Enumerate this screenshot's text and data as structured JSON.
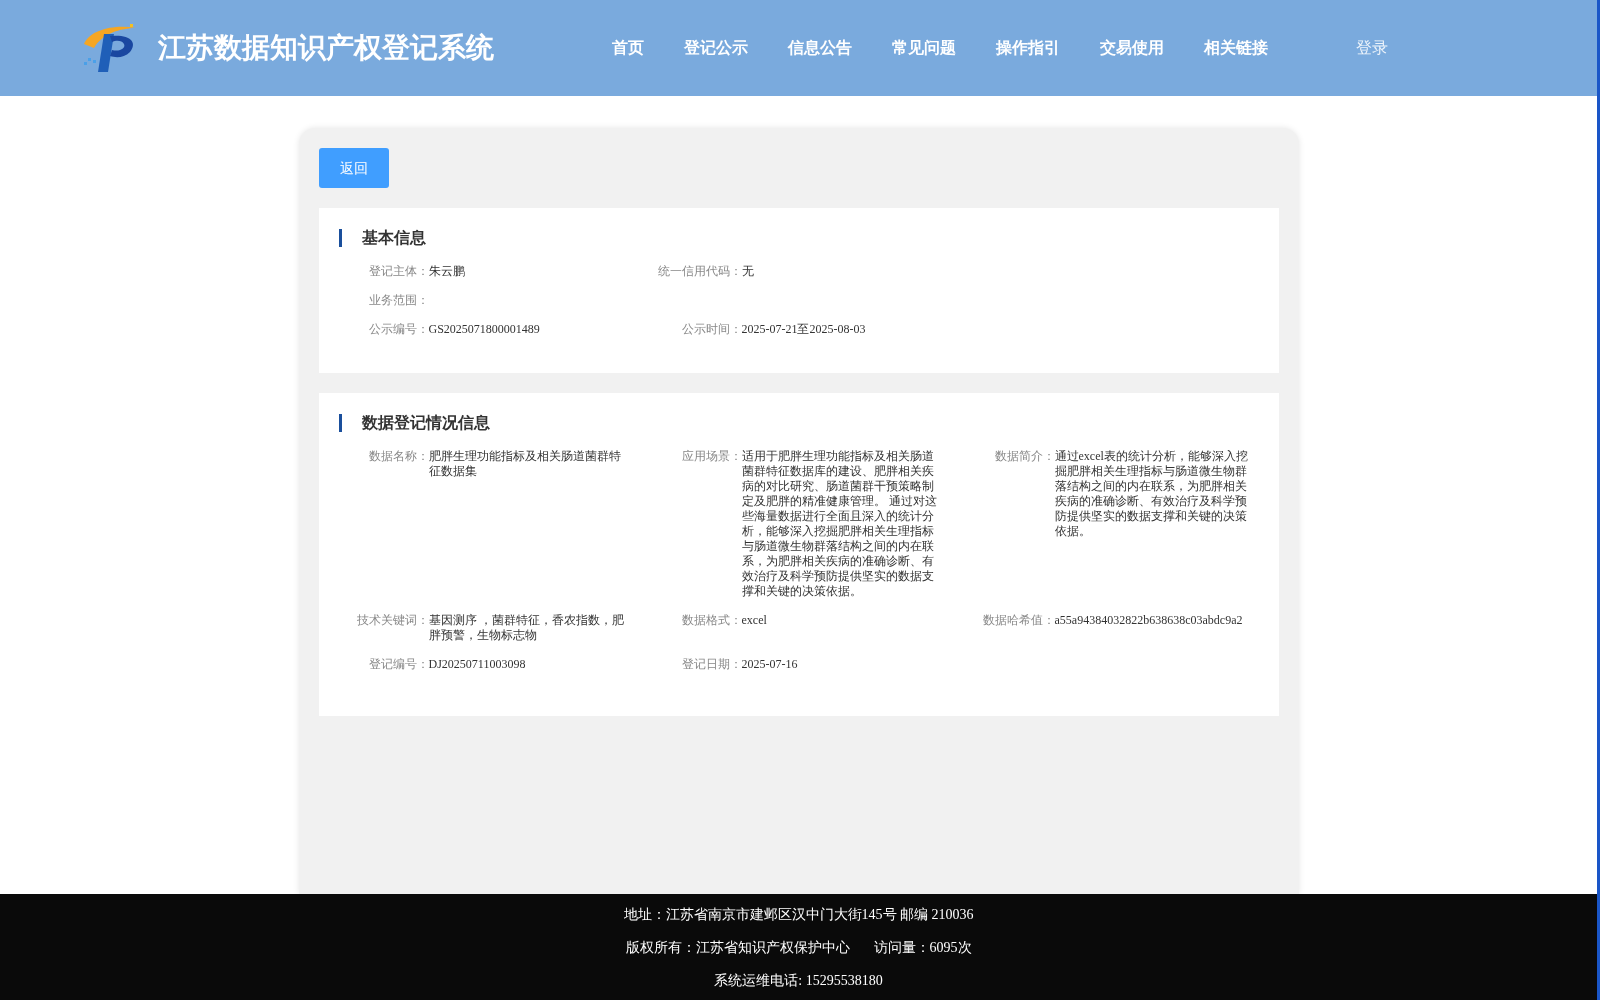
{
  "header": {
    "title": "江苏数据知识产权登记系统",
    "nav": [
      {
        "label": "首页"
      },
      {
        "label": "登记公示"
      },
      {
        "label": "信息公告"
      },
      {
        "label": "常见问题"
      },
      {
        "label": "操作指引"
      },
      {
        "label": "交易使用"
      },
      {
        "label": "相关链接"
      }
    ],
    "login": "登录"
  },
  "back_button": "返回",
  "sections": [
    {
      "title": "基本信息",
      "rows": [
        [
          {
            "label": "登记主体：",
            "value": "朱云鹏"
          },
          {
            "label": "统一信用代码：",
            "value": "无"
          }
        ],
        [
          {
            "label": "业务范围："
          }
        ],
        [
          {
            "label": "公示编号：",
            "value": "GS2025071800001489"
          },
          {
            "label": "公示时间：",
            "value": "2025-07-21至2025-08-03"
          }
        ]
      ]
    },
    {
      "title": "数据登记情况信息",
      "rows": [
        [
          {
            "label": "数据名称：",
            "value": "肥胖生理功能指标及相关肠道菌群特征数据集"
          },
          {
            "label": "应用场景：",
            "value": "适用于肥胖生理功能指标及相关肠道菌群特征数据库的建设、肥胖相关疾病的对比研究、肠道菌群干预策略制定及肥胖的精准健康管理。 通过对这些海量数据进行全面且深入的统计分析，能够深入挖掘肥胖相关生理指标与肠道微生物群落结构之间的内在联系，为肥胖相关疾病的准确诊断、有效治疗及科学预防提供坚实的数据支撑和关键的决策依据。"
          },
          {
            "label": "数据简介：",
            "value": "通过excel表的统计分析，能够深入挖掘肥胖相关生理指标与肠道微生物群落结构之间的内在联系，为肥胖相关疾病的准确诊断、有效治疗及科学预防提供坚实的数据支撑和关键的决策依据。"
          }
        ],
        [
          {
            "label": "技术关键词：",
            "value": "基因测序 ，菌群特征，香农指数，肥胖预警，生物标志物"
          },
          {
            "label": "数据格式：",
            "value": "excel"
          },
          {
            "label": "数据哈希值：",
            "value": "a55a94384032822b638638c03abdc9a2"
          }
        ],
        [
          {
            "label": "登记编号：",
            "value": "DJ20250711003098"
          },
          {
            "label": "登记日期：",
            "value": "2025-07-16"
          }
        ]
      ]
    }
  ],
  "footer": [
    "地址：江苏省南京市建邺区汉中门大街145号 邮编 210036",
    "版权所有：江苏省知识产权保护中心",
    "访问量：6095次",
    "系统运维电话: 15295538180"
  ]
}
